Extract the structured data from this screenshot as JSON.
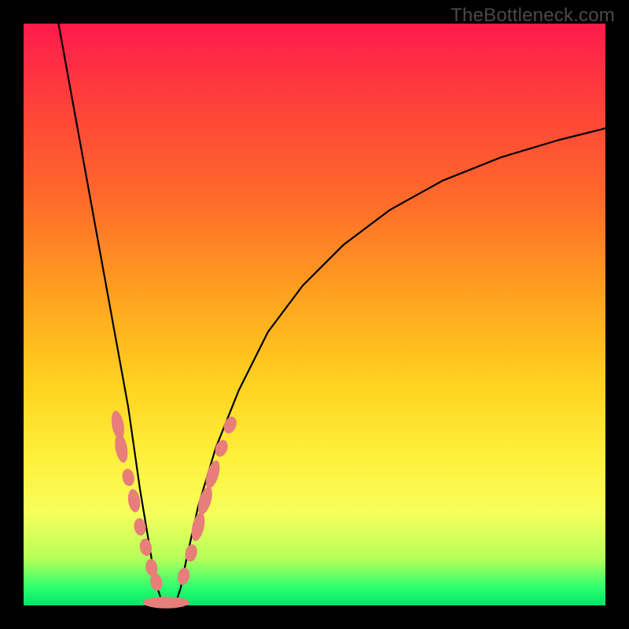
{
  "watermark": "TheBottleneck.com",
  "colors": {
    "frame": "#000000",
    "gradient_top": "#ff1a4d",
    "gradient_bottom": "#00e668",
    "curve": "#000000",
    "beads": "#e77e7a"
  },
  "chart_data": {
    "type": "line",
    "title": "",
    "xlabel": "",
    "ylabel": "",
    "xlim": [
      0,
      100
    ],
    "ylim": [
      0,
      100
    ],
    "grid": false,
    "legend": false,
    "annotations": [
      "TheBottleneck.com"
    ],
    "note": "Axes are unlabeled; x and y are normalized 0–100. y≈100 at top (red, high bottleneck), y≈0 at bottom (green, low bottleneck). Values estimated from pixels.",
    "series": [
      {
        "name": "bottleneck-curve",
        "x": [
          6,
          8,
          10,
          12,
          14,
          16,
          18,
          19,
          20,
          21,
          22,
          23,
          24,
          25,
          26,
          27,
          28,
          30,
          33,
          37,
          42,
          48,
          55,
          63,
          72,
          82,
          92,
          100
        ],
        "y": [
          100,
          89,
          78,
          67,
          56,
          45,
          34,
          27,
          20,
          14,
          8,
          3,
          0,
          0,
          0,
          3,
          8,
          17,
          27,
          37,
          47,
          55,
          62,
          68,
          73,
          77,
          80,
          82
        ]
      }
    ],
    "markers": [
      {
        "name": "beads-left",
        "note": "Pink capsule/oval markers along lower-left arm of curve (approx positions, normalized).",
        "points": [
          {
            "x": 16.2,
            "y": 31.0,
            "shape": "capsule",
            "len": 5
          },
          {
            "x": 16.8,
            "y": 27.0,
            "shape": "capsule",
            "len": 5
          },
          {
            "x": 18.0,
            "y": 22.0,
            "shape": "oval",
            "len": 3
          },
          {
            "x": 19.0,
            "y": 18.0,
            "shape": "capsule",
            "len": 4
          },
          {
            "x": 20.0,
            "y": 13.5,
            "shape": "oval",
            "len": 3
          },
          {
            "x": 21.0,
            "y": 10.0,
            "shape": "oval",
            "len": 3
          },
          {
            "x": 22.0,
            "y": 6.5,
            "shape": "oval",
            "len": 3
          },
          {
            "x": 22.8,
            "y": 4.0,
            "shape": "oval",
            "len": 3
          }
        ]
      },
      {
        "name": "beads-bottom",
        "note": "Pink capsule along valley floor.",
        "points": [
          {
            "x": 24.5,
            "y": 0.5,
            "shape": "capsule",
            "len": 8
          }
        ]
      },
      {
        "name": "beads-right",
        "note": "Pink capsule/oval markers along lower-right arm of curve.",
        "points": [
          {
            "x": 27.5,
            "y": 5.0,
            "shape": "oval",
            "len": 3
          },
          {
            "x": 28.8,
            "y": 9.0,
            "shape": "oval",
            "len": 3
          },
          {
            "x": 30.0,
            "y": 13.5,
            "shape": "capsule",
            "len": 5
          },
          {
            "x": 31.2,
            "y": 18.0,
            "shape": "capsule",
            "len": 5
          },
          {
            "x": 32.5,
            "y": 22.5,
            "shape": "capsule",
            "len": 5
          },
          {
            "x": 34.0,
            "y": 27.0,
            "shape": "oval",
            "len": 3
          },
          {
            "x": 35.5,
            "y": 31.0,
            "shape": "oval",
            "len": 3
          }
        ]
      }
    ]
  }
}
